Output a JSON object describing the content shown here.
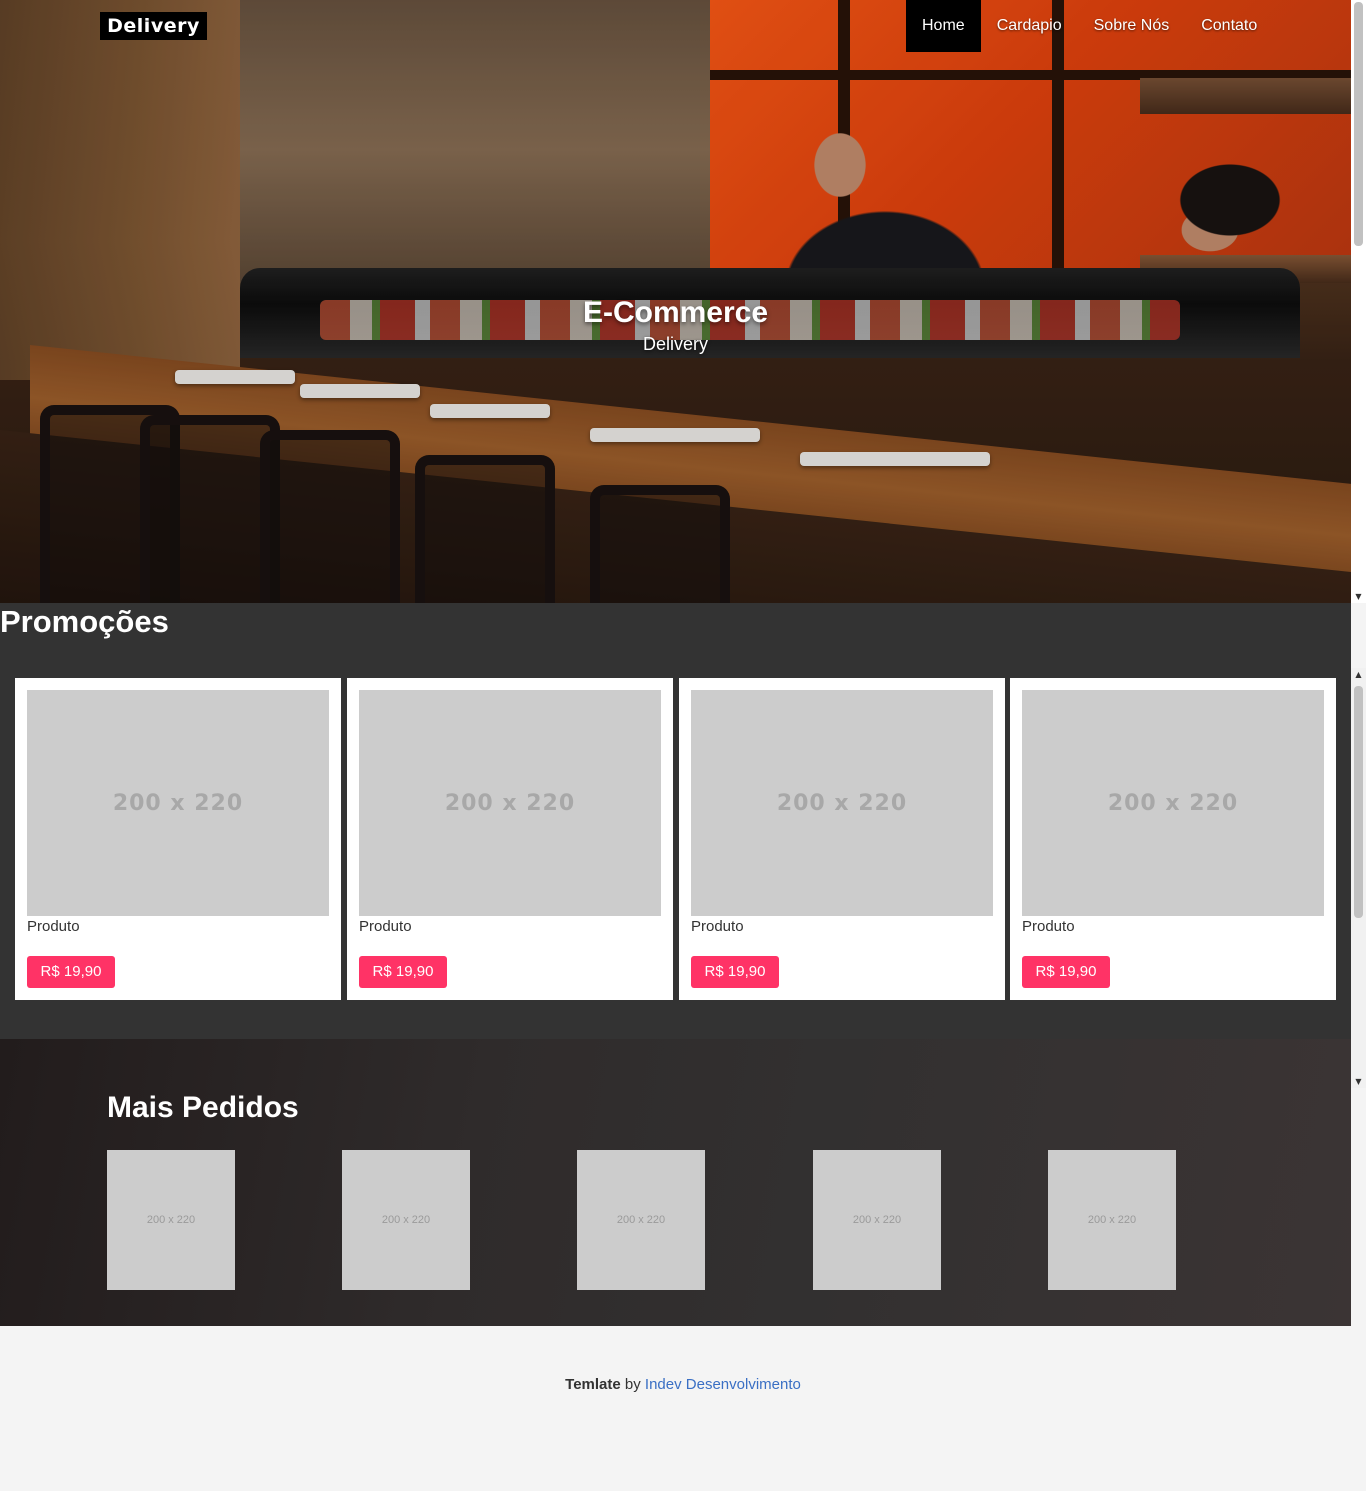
{
  "header": {
    "logo": "Delivery",
    "nav": [
      {
        "label": "Home",
        "active": true
      },
      {
        "label": "Cardapio",
        "active": false
      },
      {
        "label": "Sobre Nós",
        "active": false
      },
      {
        "label": "Contato",
        "active": false
      }
    ]
  },
  "hero": {
    "title": "E-Commerce",
    "subtitle": "Delivery"
  },
  "promocoes": {
    "title": "Promoções",
    "products": [
      {
        "image_placeholder": "200 x 220",
        "name": "Produto",
        "price": "R$ 19,90"
      },
      {
        "image_placeholder": "200 x 220",
        "name": "Produto",
        "price": "R$ 19,90"
      },
      {
        "image_placeholder": "200 x 220",
        "name": "Produto",
        "price": "R$ 19,90"
      },
      {
        "image_placeholder": "200 x 220",
        "name": "Produto",
        "price": "R$ 19,90"
      }
    ]
  },
  "mais_pedidos": {
    "title": "Mais Pedidos",
    "items": [
      {
        "image_placeholder": "200 x 220"
      },
      {
        "image_placeholder": "200 x 220"
      },
      {
        "image_placeholder": "200 x 220"
      },
      {
        "image_placeholder": "200 x 220"
      },
      {
        "image_placeholder": "200 x 220"
      }
    ]
  },
  "footer": {
    "credit_bold": "Temlate",
    "credit_by": "by",
    "credit_link": "Indev Desenvolvimento"
  },
  "colors": {
    "accent": "#ff3366",
    "section_dark": "#333333",
    "link": "#3a6fc4",
    "placeholder": "#cccccc"
  }
}
